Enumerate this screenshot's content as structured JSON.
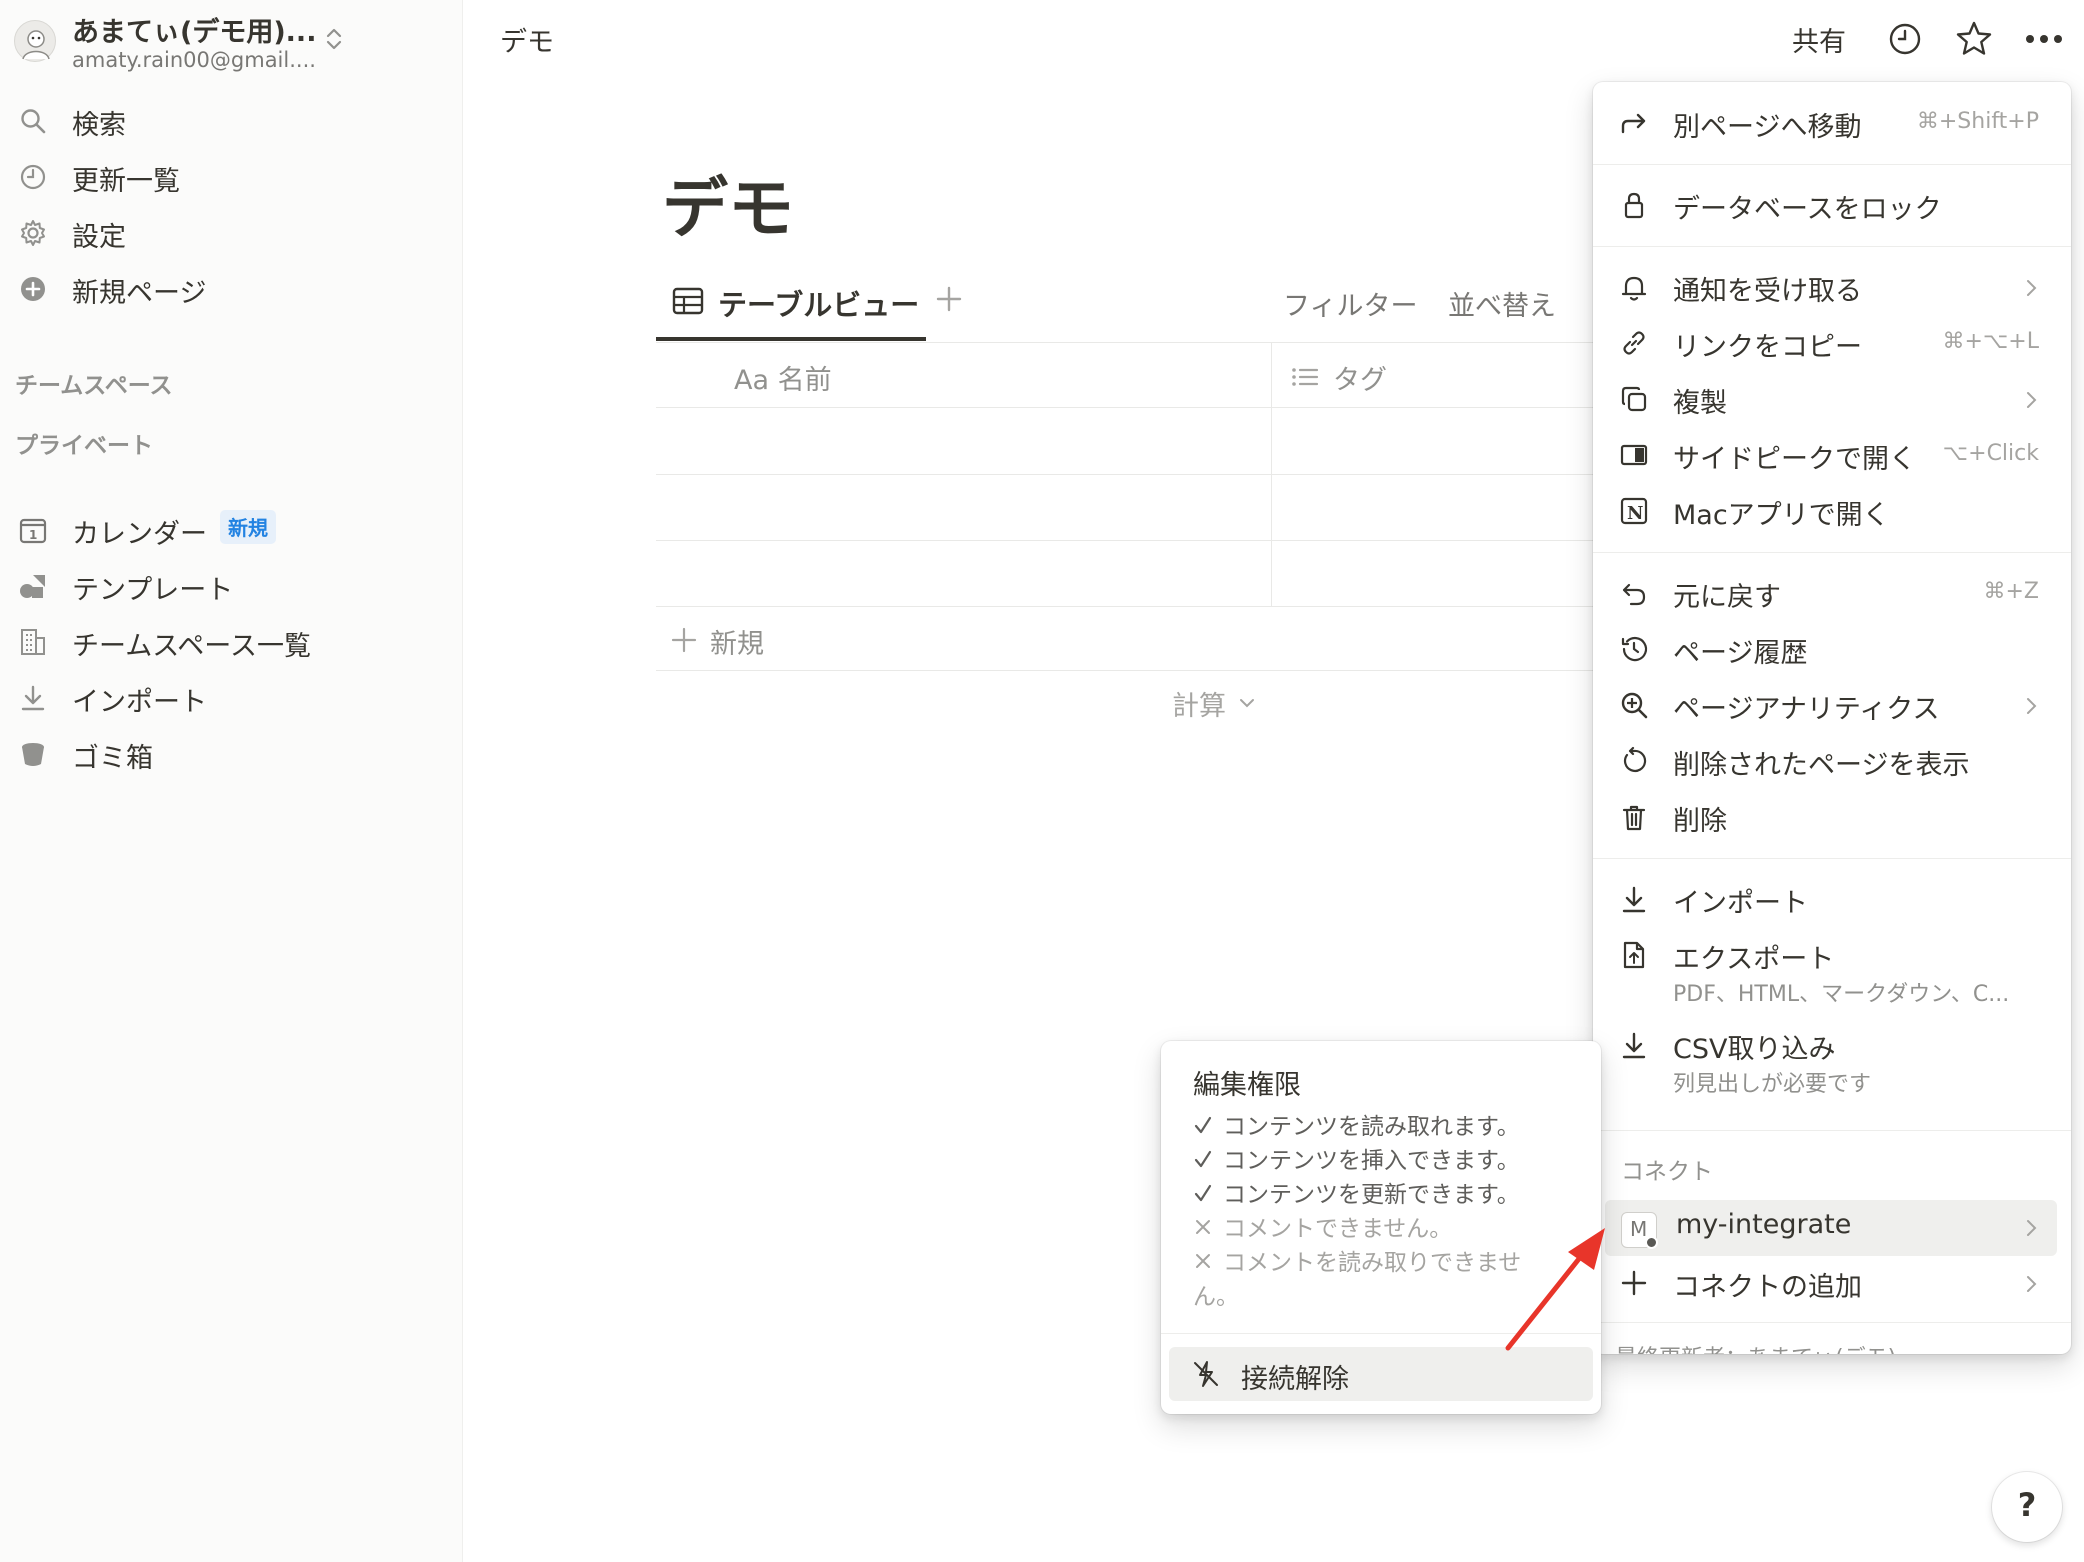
{
  "sidebar": {
    "workspace_name": "あまてぃ(デモ用)...",
    "workspace_email": "amaty.rain00@gmail....",
    "top_items": [
      {
        "label": "検索",
        "icon": "search-icon"
      },
      {
        "label": "更新一覧",
        "icon": "clock-icon"
      },
      {
        "label": "設定",
        "icon": "gear-icon"
      },
      {
        "label": "新規ページ",
        "icon": "plus-circle-icon"
      }
    ],
    "section_teamspace": "チームスペース",
    "section_private": "プライベート",
    "bottom_items": [
      {
        "label": "カレンダー",
        "icon": "calendar-icon",
        "badge": "新規"
      },
      {
        "label": "テンプレート",
        "icon": "template-shapes-icon"
      },
      {
        "label": "チームスペース一覧",
        "icon": "building-icon"
      },
      {
        "label": "インポート",
        "icon": "download-icon"
      },
      {
        "label": "ゴミ箱",
        "icon": "trash-icon"
      }
    ]
  },
  "topbar": {
    "breadcrumb": "デモ",
    "share": "共有"
  },
  "page": {
    "title": "デモ",
    "view_tab": "テーブルビュー",
    "filter": "フィルター",
    "sort": "並べ替え",
    "columns": [
      {
        "label": "Aa 名前",
        "icon": "text-icon"
      },
      {
        "label": "タグ",
        "icon": "list-icon"
      }
    ],
    "rows": [
      {
        "name": "",
        "tag": ""
      },
      {
        "name": "",
        "tag": ""
      },
      {
        "name": "",
        "tag": ""
      }
    ],
    "new_row": "新規",
    "calculate": "計算"
  },
  "menu": {
    "items": {
      "move": {
        "label": "別ページへ移動",
        "shortcut": "⌘+Shift+P"
      },
      "lock": {
        "label": "データベースをロック"
      },
      "notify": {
        "label": "通知を受け取る"
      },
      "copy_link": {
        "label": "リンクをコピー",
        "shortcut": "⌘+⌥+L"
      },
      "duplicate": {
        "label": "複製"
      },
      "side_peek": {
        "label": "サイドピークで開く",
        "shortcut": "⌥+Click"
      },
      "mac_app": {
        "label": "Macアプリで開く"
      },
      "undo": {
        "label": "元に戻す",
        "shortcut": "⌘+Z"
      },
      "history": {
        "label": "ページ履歴"
      },
      "analytics": {
        "label": "ページアナリティクス"
      },
      "deleted_pages": {
        "label": "削除されたページを表示"
      },
      "delete": {
        "label": "削除"
      },
      "import": {
        "label": "インポート"
      },
      "export": {
        "label": "エクスポート",
        "sub": "PDF、HTML、マークダウン、C..."
      },
      "csv_import": {
        "label": "CSV取り込み",
        "sub": "列見出しが必要です"
      }
    },
    "connect_title": "コネクト",
    "connection": {
      "name": "my-integrate",
      "avatar_letter": "M"
    },
    "add_connection": "コネクトの追加",
    "last_edited": "最終更新者：あまてぃ(デモ)"
  },
  "permissions": {
    "title": "編集権限",
    "items": [
      {
        "text": "コンテンツを読み取れます。",
        "allowed": true
      },
      {
        "text": "コンテンツを挿入できます。",
        "allowed": true
      },
      {
        "text": "コンテンツを更新できます。",
        "allowed": true
      },
      {
        "text": "コメントできません。",
        "allowed": false
      },
      {
        "text": "コメントを読み取りできませ",
        "allowed": false
      },
      {
        "text": "ん。",
        "allowed": false
      }
    ],
    "disconnect": "接続解除"
  },
  "help": "?",
  "colors": {
    "text": "#37352f",
    "muted": "#91918e",
    "accent": "#2383e2",
    "annotation_arrow": "#e8352a"
  }
}
